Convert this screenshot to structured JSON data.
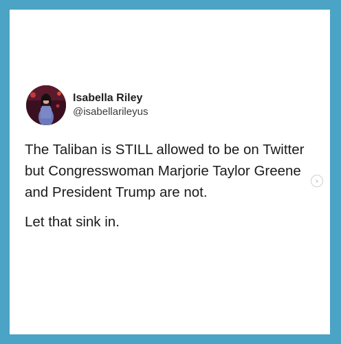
{
  "post": {
    "author": {
      "name": "Isabella Riley",
      "handle": "@isabellarileyus"
    },
    "paragraphs": [
      "The Taliban is STILL allowed to be on Twitter but Congresswoman Marjorie Taylor Greene and President Trump are not.",
      "Let that sink in."
    ]
  },
  "carousel": {
    "next_icon": "chevron-right-icon",
    "next_glyph": "›"
  },
  "colors": {
    "frame_border": "#4ba3c5",
    "card_background": "#ffffff",
    "text": "#1a1a1a"
  }
}
